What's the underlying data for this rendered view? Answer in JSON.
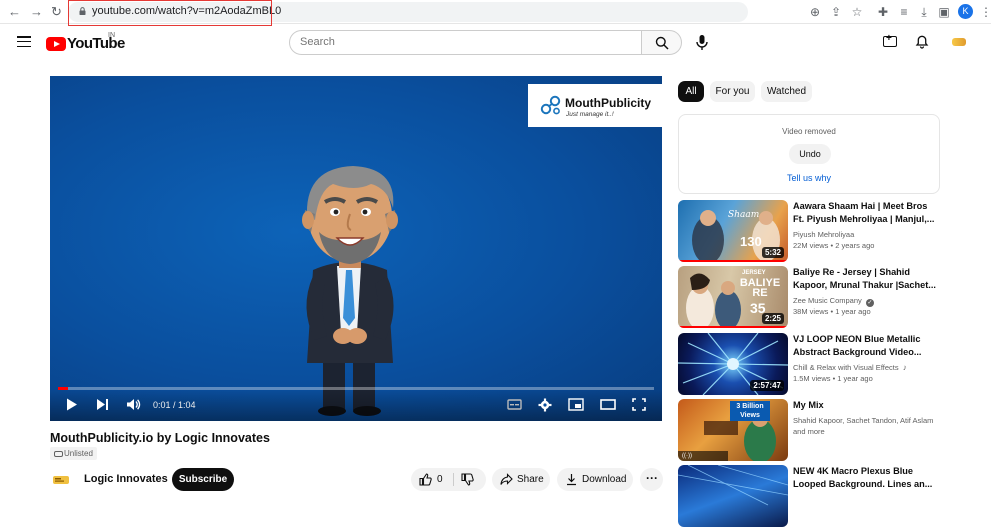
{
  "browser": {
    "url": "youtube.com/watch?v=m2AodaZmBL0",
    "profile_initial": "K"
  },
  "header": {
    "logo_text": "YouTube",
    "region": "IN",
    "search_placeholder": "Search"
  },
  "player": {
    "time": "0:01 / 1:04",
    "progress_fraction": 0.016,
    "brand_name": "MouthPublicity",
    "brand_tagline": "Just manage it..!"
  },
  "video": {
    "title": "MouthPublicity.io by Logic Innovates",
    "visibility": "Unlisted",
    "channel": "Logic Innovates",
    "subscribe_label": "Subscribe",
    "like_count": "0",
    "share_label": "Share",
    "download_label": "Download"
  },
  "sidebar": {
    "chips": [
      "All",
      "For you",
      "Watched"
    ],
    "removed_text": "Video removed",
    "undo_label": "Undo",
    "tell_why_label": "Tell us why",
    "recommendations": [
      {
        "title": "Aawara Shaam Hai | Meet Bros Ft. Piyush Mehroliyaa | Manjul,...",
        "channel": "Piyush Mehroliyaa",
        "meta": "22M views • 2 years ago",
        "duration": "5:32",
        "thumb_text": "130",
        "watched_fraction": 1.0
      },
      {
        "title": "Baliye Re - Jersey | Shahid Kapoor, Mrunal Thakur |Sachet...",
        "channel": "Zee Music Company",
        "meta": "38M views • 1 year ago",
        "duration": "2:25",
        "thumb_text": "BALIYE RE",
        "watched_fraction": 1.0
      },
      {
        "title": "VJ LOOP NEON Blue Metallic Abstract Background Video...",
        "channel": "Chill & Relax with Visual Effects",
        "meta": "1.5M views • 1 year ago",
        "duration": "2:57:47",
        "thumb_text": "",
        "watched_fraction": 0
      },
      {
        "title": "My Mix",
        "channel": "Shahid Kapoor, Sachet Tandon, Atif Aslam and more",
        "meta": "",
        "duration": "",
        "thumb_text": "3 Billion Views",
        "watched_fraction": 0
      },
      {
        "title": "NEW 4K Macro Plexus Blue Looped Background. Lines an...",
        "channel": "",
        "meta": "",
        "duration": "",
        "thumb_text": "",
        "watched_fraction": 0
      }
    ]
  }
}
